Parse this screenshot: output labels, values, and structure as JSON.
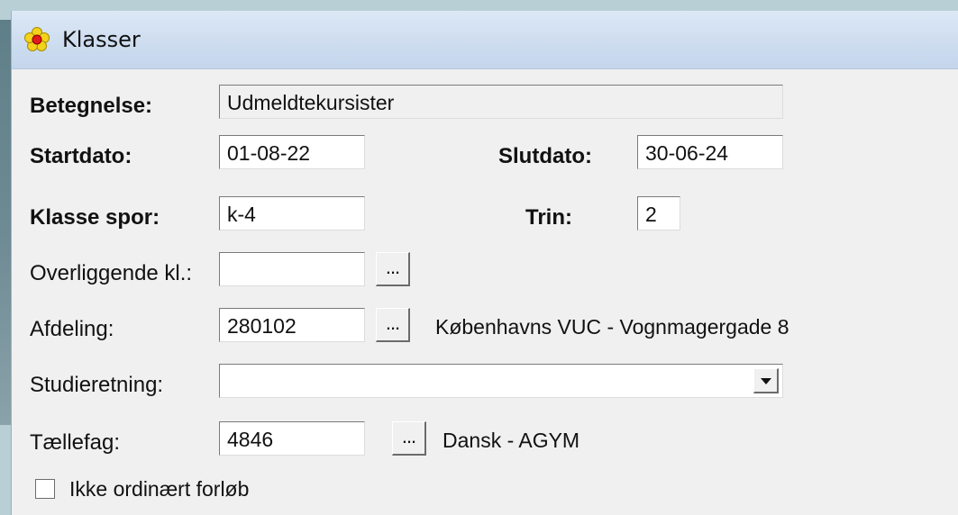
{
  "window": {
    "title": "Klasser",
    "icon": "flower-icon"
  },
  "fields": {
    "betegnelse": {
      "label": "Betegnelse:",
      "value": "Udmeldtekursister"
    },
    "startdato": {
      "label": "Startdato:",
      "value": "01-08-22"
    },
    "slutdato": {
      "label": "Slutdato:",
      "value": "30-06-24"
    },
    "klasse_spor": {
      "label": "Klasse spor:",
      "value": "k-4"
    },
    "trin": {
      "label": "Trin:",
      "value": "2"
    },
    "overliggende": {
      "label": "Overliggende kl.:",
      "value": "",
      "button": "..."
    },
    "afdeling": {
      "label": "Afdeling:",
      "value": "280102",
      "button": "...",
      "description": "Københavns VUC - Vognmagergade 8"
    },
    "studieretning": {
      "label": "Studieretning:",
      "value": ""
    },
    "taellefag": {
      "label": "Tællefag:",
      "value": "4846",
      "button": "...",
      "description": "Dansk - AGYM"
    }
  },
  "checkbox": {
    "label": "Ikke ordinært forløb",
    "checked": false
  },
  "colors": {
    "titlebar": "#cfdef0",
    "form_bg": "#f0f0f0",
    "field_bg": "#ffffff"
  }
}
